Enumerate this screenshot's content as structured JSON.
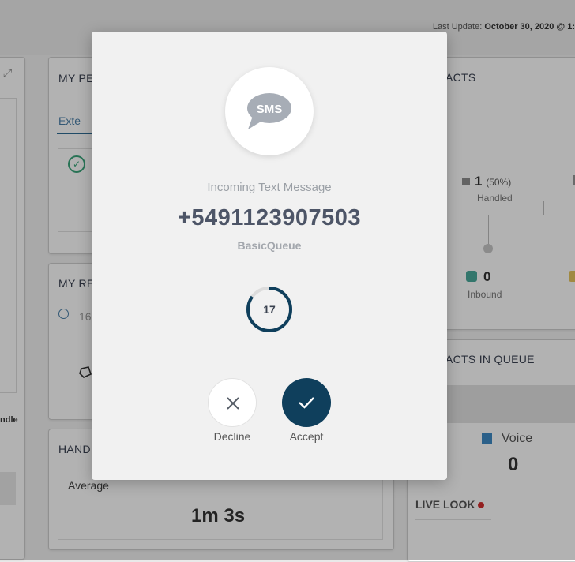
{
  "dashboard": {
    "last_update_label": "Last Update:",
    "last_update_value": "October 30, 2020 @ 1:",
    "panels": {
      "performance_title": "MY PE",
      "performance_tab": "Exte",
      "resources_title": "MY RE",
      "resources_value": "16",
      "handle_title": "HAND",
      "handle_avg_label": "Average",
      "handle_avg_value": "1m 3s",
      "contacts_title": "ACTS",
      "handled_count": "1",
      "handled_pct": "(50%)",
      "handled_label": "Handled",
      "inbound_count": "0",
      "inbound_label": "Inbound",
      "queue_title": "ACTS IN QUEUE",
      "voice_label": "Voice",
      "voice_count": "0",
      "live_look_label": "LIVE LOOK",
      "left_handle_text": "ndle"
    }
  },
  "modal": {
    "icon": "sms-bubble-icon",
    "icon_text": "SMS",
    "incoming_label": "Incoming Text Message",
    "phone_number": "+5491123907503",
    "queue_name": "BasicQueue",
    "timer_value": "17",
    "timer_progress": 0.85,
    "decline_label": "Decline",
    "accept_label": "Accept"
  },
  "colors": {
    "accept_bg": "#0f3f5c",
    "phone_text": "#4d5567",
    "timer_ring": "#0f3f5c",
    "inbound": "#4aa99b",
    "voice": "#3e8ac5",
    "live_dot": "#d32f2f"
  }
}
